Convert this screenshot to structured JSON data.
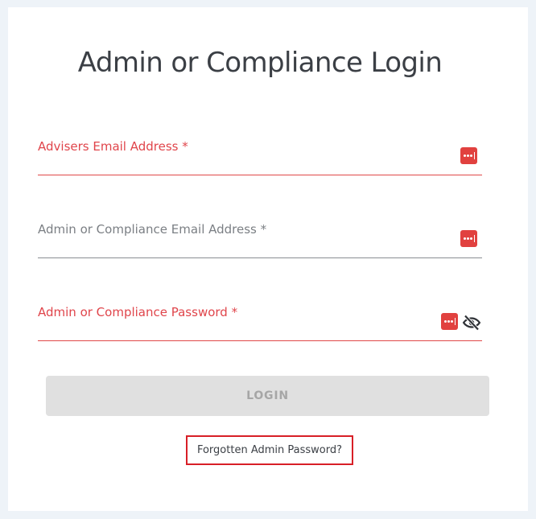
{
  "title": "Admin or Compliance Login",
  "fields": [
    {
      "label": "Advisers Email Address *",
      "value": ""
    },
    {
      "label": "Admin or Compliance Email Address *",
      "value": ""
    },
    {
      "label": "Admin or Compliance Password *",
      "value": ""
    }
  ],
  "icons": {
    "password_manager": "password-manager-icon",
    "visibility": "eye-off-icon"
  },
  "login_button": "LOGIN",
  "forgot_link": "Forgotten Admin Password?",
  "colors": {
    "accent_red": "#e0454b",
    "title_text": "#3b3f45",
    "button_bg": "#e0e0e0",
    "button_text": "#a6a6a6",
    "highlight_box": "#d81f27",
    "page_bg": "#eef3f8"
  }
}
